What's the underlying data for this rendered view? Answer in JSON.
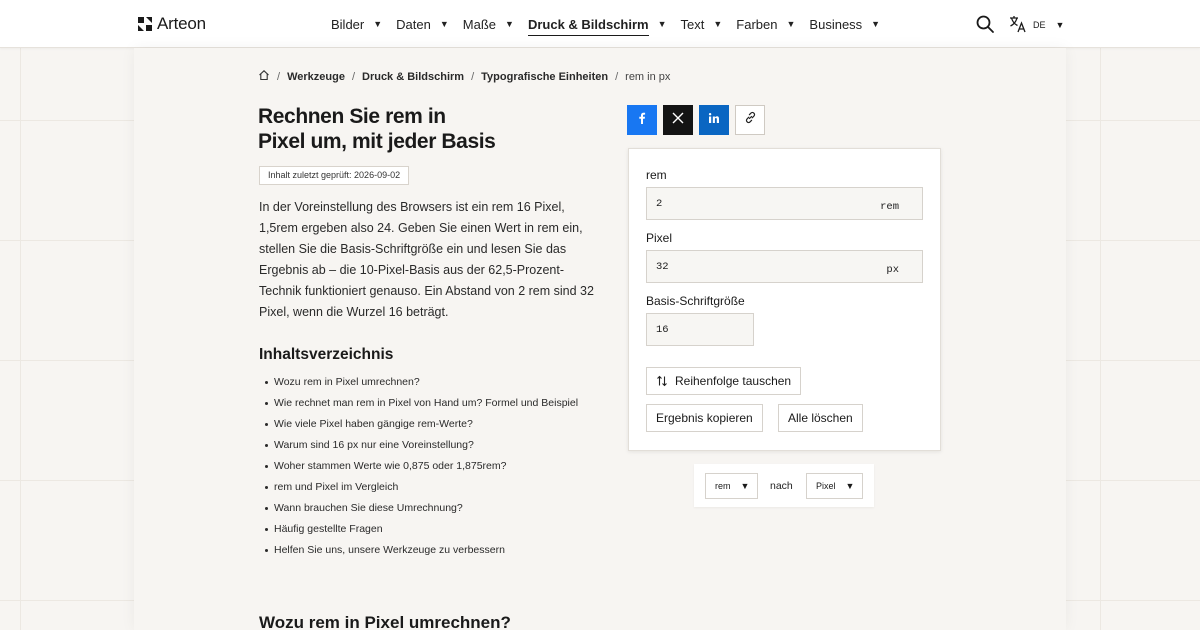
{
  "header": {
    "brand": "Arteon",
    "nav": [
      {
        "label": "Bilder",
        "active": false
      },
      {
        "label": "Daten",
        "active": false
      },
      {
        "label": "Maße",
        "active": false
      },
      {
        "label": "Druck & Bildschirm",
        "active": true
      },
      {
        "label": "Text",
        "active": false
      },
      {
        "label": "Farben",
        "active": false
      },
      {
        "label": "Business",
        "active": false
      }
    ],
    "search_icon": "search-icon",
    "language": "DE"
  },
  "breadcrumb": {
    "home_icon": "home-icon",
    "items": [
      "Werkzeuge",
      "Druck & Bildschirm",
      "Typografische Einheiten"
    ],
    "current": "rem in px"
  },
  "article": {
    "title_line1": "Rechnen Sie rem in",
    "title_line2": "Pixel um, mit jeder Basis",
    "review_badge": "Inhalt zuletzt geprüft: 2026-09-02",
    "intro": "In der Voreinstellung des Browsers ist ein rem 16 Pixel, 1,5rem ergeben also 24. Geben Sie einen Wert in rem ein, stellen Sie die Basis-Schriftgröße ein und lesen Sie das Ergebnis ab – die 10-Pixel-Basis aus der 62,5-Prozent-Technik funktioniert genauso. Ein Abstand von 2 rem sind 32 Pixel, wenn die Wurzel 16 beträgt.",
    "toc_title": "Inhaltsverzeichnis",
    "toc": [
      "Wozu rem in Pixel umrechnen?",
      "Wie rechnet man rem in Pixel von Hand um? Formel und Beispiel",
      "Wie viele Pixel haben gängige rem-Werte?",
      "Warum sind 16 px nur eine Voreinstellung?",
      "Woher stammen Werte wie 0,875 oder 1,875rem?",
      "rem und Pixel im Vergleich",
      "Wann brauchen Sie diese Umrechnung?",
      "Häufig gestellte Fragen",
      "Helfen Sie uns, unsere Werkzeuge zu verbessern"
    ],
    "section_heading": "Wozu rem in Pixel umrechnen?"
  },
  "share": {
    "icons": [
      "facebook-icon",
      "x-icon",
      "linkedin-icon",
      "link-icon"
    ],
    "colors": {
      "facebook": "#1877f2",
      "x": "#141414",
      "linkedin": "#0a66c2"
    }
  },
  "converter": {
    "rem_label": "rem",
    "rem_value": "2",
    "rem_unit": "rem",
    "px_label": "Pixel",
    "px_value": "32",
    "px_unit": "px",
    "base_label": "Basis-Schriftgröße",
    "base_value": "16",
    "swap_label": "Reihenfolge tauschen",
    "copy_label": "Ergebnis kopieren",
    "clear_label": "Alle löschen"
  },
  "direction": {
    "from": "rem",
    "middle": "nach",
    "to": "Pixel"
  }
}
